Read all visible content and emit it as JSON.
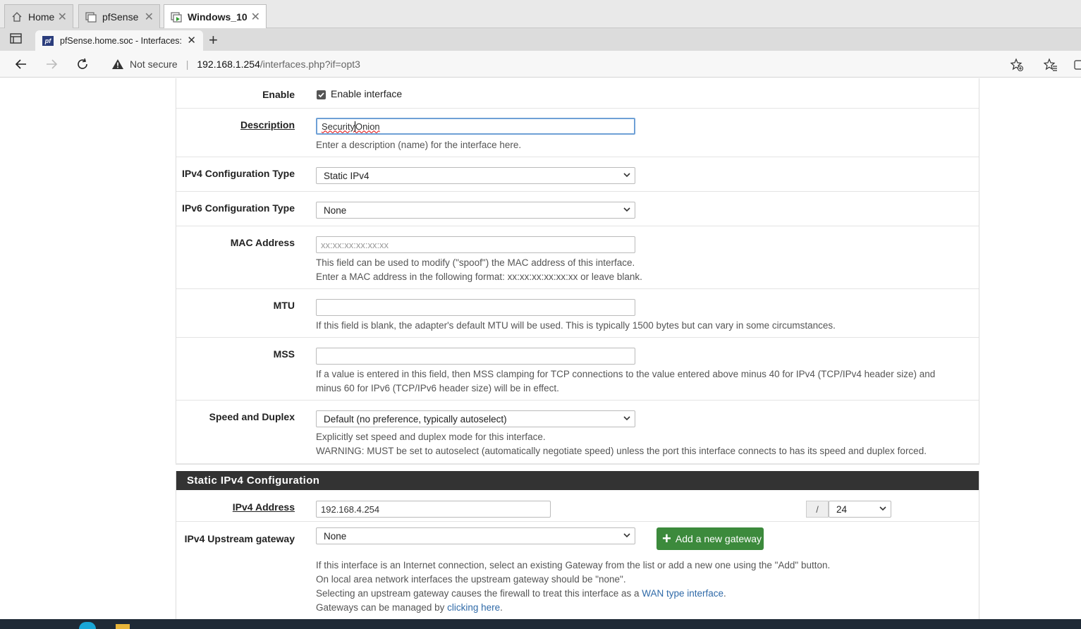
{
  "vm_tabs": [
    {
      "label": "Home",
      "icon": "home-icon"
    },
    {
      "label": "pfSense",
      "icon": "vm-icon"
    },
    {
      "label": "Windows_10",
      "icon": "vm-running-icon"
    }
  ],
  "browser": {
    "tab_title": "pfSense.home.soc - Interfaces: O",
    "favicon_text": "pf",
    "new_tab": "+",
    "security": "Not secure",
    "url_host": "192.168.1.254",
    "url_path": "/interfaces.php?if=opt3"
  },
  "form": {
    "enable": {
      "label": "Enable",
      "checkbox_label": "Enable interface",
      "checked": true
    },
    "description": {
      "label": "Description",
      "value_part1": "Security",
      "value_part2": "Onion",
      "help": "Enter a description (name) for the interface here."
    },
    "ipv4_type": {
      "label": "IPv4 Configuration Type",
      "value": "Static IPv4"
    },
    "ipv6_type": {
      "label": "IPv6 Configuration Type",
      "value": "None"
    },
    "mac": {
      "label": "MAC Address",
      "placeholder": "xx:xx:xx:xx:xx:xx",
      "help1": "This field can be used to modify (\"spoof\") the MAC address of this interface.",
      "help2": "Enter a MAC address in the following format: xx:xx:xx:xx:xx:xx or leave blank."
    },
    "mtu": {
      "label": "MTU",
      "value": "",
      "help": "If this field is blank, the adapter's default MTU will be used. This is typically 1500 bytes but can vary in some circumstances."
    },
    "mss": {
      "label": "MSS",
      "value": "",
      "help1": "If a value is entered in this field, then MSS clamping for TCP connections to the value entered above minus 40 for IPv4 (TCP/IPv4 header size) and",
      "help2": "minus 60 for IPv6 (TCP/IPv6 header size) will be in effect."
    },
    "speed": {
      "label": "Speed and Duplex",
      "value": "Default (no preference, typically autoselect)",
      "help1": "Explicitly set speed and duplex mode for this interface.",
      "help2": "WARNING: MUST be set to autoselect (automatically negotiate speed) unless the port this interface connects to has its speed and duplex forced."
    }
  },
  "static_ipv4": {
    "header": "Static IPv4 Configuration",
    "address_label": "IPv4 Address",
    "address_value": "192.168.4.254",
    "slash": "/",
    "cidr": "24",
    "gateway_label": "IPv4 Upstream gateway",
    "gateway_value": "None",
    "add_gateway": "Add a new gateway",
    "help1": "If this interface is an Internet connection, select an existing Gateway from the list or add a new one using the \"Add\" button.",
    "help2": "On local area network interfaces the upstream gateway should be \"none\".",
    "help3_prefix": "Selecting an upstream gateway causes the firewall to treat this interface as a ",
    "help3_link": "WAN type interface",
    "help3_suffix": ".",
    "help4_prefix": "Gateways can be managed by ",
    "help4_link": "clicking here",
    "help4_suffix": "."
  }
}
